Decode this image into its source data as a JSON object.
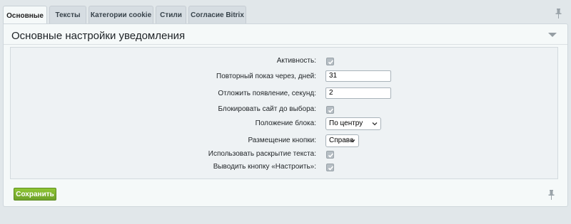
{
  "tabs": [
    {
      "label": "Основные",
      "active": true
    },
    {
      "label": "Тексты",
      "active": false
    },
    {
      "label": "Категории cookie",
      "active": false
    },
    {
      "label": "Стили",
      "active": false
    },
    {
      "label": "Согласие Bitrix",
      "active": false
    }
  ],
  "panel": {
    "title": "Основные настройки уведомления"
  },
  "form": {
    "active_label": "Активность:",
    "active_checked": true,
    "repeat_label": "Повторный показ через, дней:",
    "repeat_value": "31",
    "delay_label": "Отложить появление, секунд:",
    "delay_value": "2",
    "block_label": "Блокировать сайт до выбора:",
    "block_checked": true,
    "position_label": "Положение блока:",
    "position_value": "По центру",
    "button_place_label": "Размещение кнопки:",
    "button_place_value": "Справа",
    "expand_label": "Использовать раскрытие текста:",
    "expand_checked": true,
    "configure_label": "Выводить кнопку «Настроить»:",
    "configure_checked": true
  },
  "footer": {
    "save_label": "Сохранить"
  },
  "colors": {
    "save_button": "#7bb12f",
    "background": "#e1e7ea",
    "panel": "#f5f9f9"
  }
}
